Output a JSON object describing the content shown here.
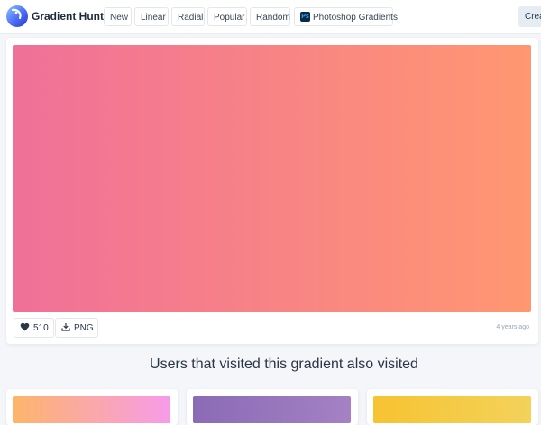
{
  "brand": {
    "name": "Gradient Hunt"
  },
  "nav": [
    {
      "label": "New"
    },
    {
      "label": "Linear"
    },
    {
      "label": "Radial"
    },
    {
      "label": "Popular"
    },
    {
      "label": "Random"
    },
    {
      "label": "Photoshop Gradients",
      "icon": "ps-icon",
      "icon_text": "Ps"
    }
  ],
  "header": {
    "create_label": "Create"
  },
  "gradient": {
    "from": "#f07099",
    "to": "#ff9771"
  },
  "actions": {
    "likes": "510",
    "download_label": "PNG",
    "timestamp": "4 years ago"
  },
  "related": {
    "title": "Users that visited this gradient also visited",
    "items": [
      {
        "from": "#fdb56a",
        "to": "#f79be9"
      },
      {
        "from": "#8a6bb5",
        "to": "#a581c4"
      },
      {
        "from": "#f6c332",
        "to": "#f3d25a"
      }
    ]
  },
  "colors": {
    "accent": "#4a6cf7",
    "text": "#1e2a3a",
    "muted": "#9aa4b2"
  }
}
